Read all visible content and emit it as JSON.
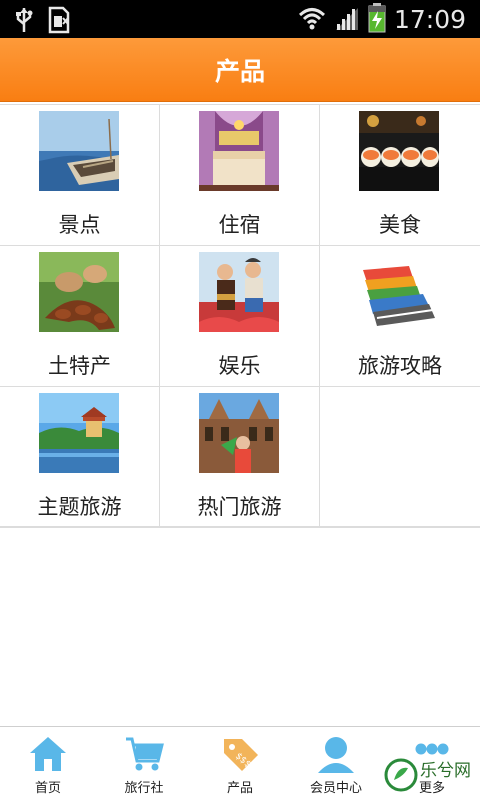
{
  "status_bar": {
    "time": "17:09",
    "icons": [
      "usb-icon",
      "sim-icon",
      "wifi-icon",
      "signal-icon",
      "battery-charging-icon"
    ]
  },
  "header": {
    "title": "产品"
  },
  "grid": {
    "items": [
      {
        "label": "景点",
        "icon": "boat-lake-photo"
      },
      {
        "label": "住宿",
        "icon": "hotel-bed-photo"
      },
      {
        "label": "美食",
        "icon": "sushi-photo"
      },
      {
        "label": "土特产",
        "icon": "tamarind-photo"
      },
      {
        "label": "娱乐",
        "icon": "dancers-photo"
      },
      {
        "label": "旅游攻略",
        "icon": "books-photo"
      },
      {
        "label": "主题旅游",
        "icon": "pagoda-lake-photo"
      },
      {
        "label": "热门旅游",
        "icon": "church-tourist-photo"
      }
    ]
  },
  "bottom_nav": {
    "items": [
      {
        "label": "首页",
        "icon": "home-icon"
      },
      {
        "label": "旅行社",
        "icon": "cart-icon"
      },
      {
        "label": "产品",
        "icon": "tag-icon"
      },
      {
        "label": "会员中心",
        "icon": "user-icon"
      },
      {
        "label": "更多",
        "icon": "more-icon"
      }
    ]
  },
  "watermark": {
    "text": "乐兮网"
  },
  "colors": {
    "header": "#f98515",
    "nav_icon": "#59b7e8",
    "border": "#dcdcdc"
  }
}
